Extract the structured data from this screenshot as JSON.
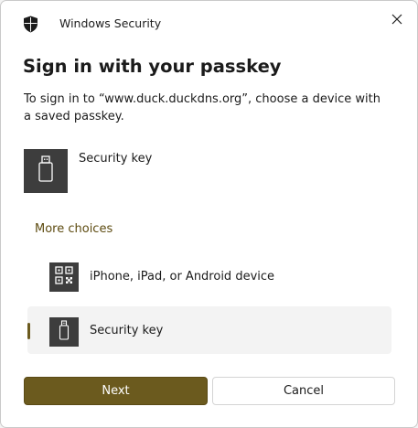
{
  "window": {
    "app_title": "Windows Security",
    "close_icon": "close-icon",
    "app_icon": "shield-icon"
  },
  "dialog": {
    "heading": "Sign in with your passkey",
    "description": "To sign in to “www.duck.duckdns.org”, choose a device with a saved passkey.",
    "default_option": {
      "label": "Security key",
      "icon": "usb-key-icon"
    },
    "more_choices_label": "More choices",
    "choices": [
      {
        "label": "iPhone, iPad, or Android device",
        "icon": "qr-code-icon",
        "selected": false
      },
      {
        "label": "Security key",
        "icon": "usb-key-icon",
        "selected": true
      }
    ]
  },
  "buttons": {
    "next_label": "Next",
    "cancel_label": "Cancel"
  },
  "colors": {
    "accent": "#6b5a1e",
    "link": "#5d4b10",
    "tile_background": "#3d3d3d",
    "selected_background": "#f3f3f3"
  }
}
